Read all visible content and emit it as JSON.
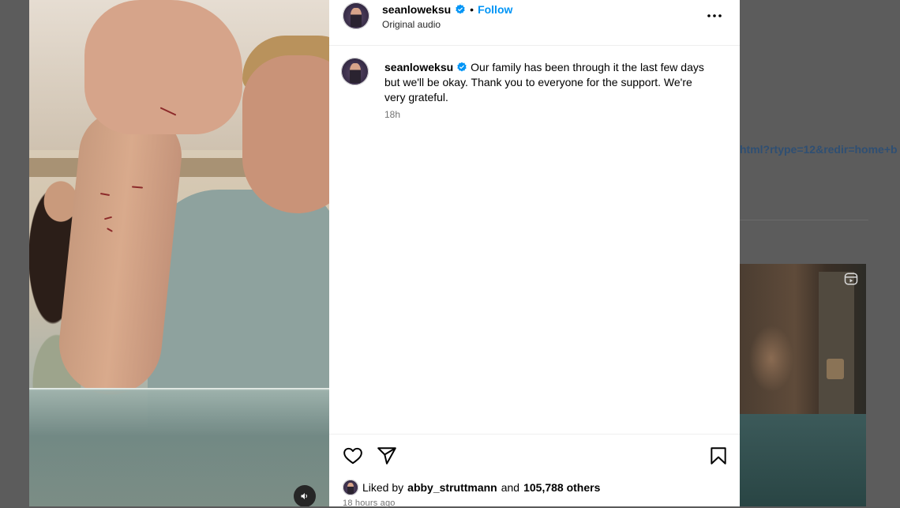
{
  "background": {
    "link_text": "html?rtype=12&redir=home+b"
  },
  "post": {
    "username": "seanloweksu",
    "follow_label": "Follow",
    "separator": "•",
    "audio_label": "Original audio",
    "caption": "Our family has been through it the last few days but we'll be okay. Thank you to everyone for the support. We're very grateful.",
    "caption_time": "18h",
    "liked_by_prefix": "Liked by",
    "liked_by_user": "abby_struttmann",
    "liked_by_and": "and",
    "liked_by_others": "105,788 others",
    "time_ago": "18 hours ago"
  },
  "colors": {
    "accent": "#0095f6",
    "verified": "#0095f6",
    "overlay": "#5c5c5c"
  },
  "icons": [
    "verified-badge-icon",
    "more-options-icon",
    "heart-icon",
    "share-icon",
    "bookmark-icon",
    "speaker-icon",
    "reels-icon"
  ]
}
